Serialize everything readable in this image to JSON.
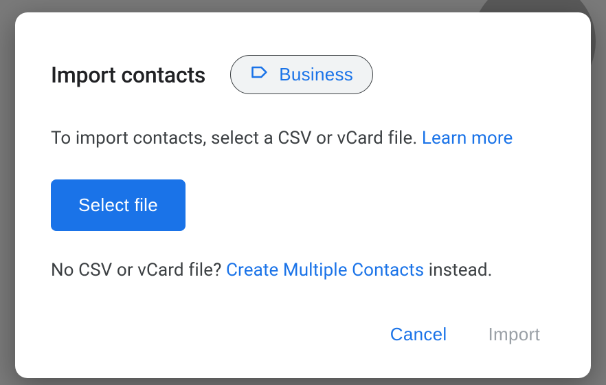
{
  "dialog": {
    "title": "Import contacts",
    "label_chip": "Business",
    "instruction_text": "To import contacts, select a CSV or vCard file. ",
    "learn_more": "Learn more",
    "select_file_button": "Select file",
    "hint_prefix": "No CSV or vCard file? ",
    "create_multiple_link": "Create Multiple Contacts",
    "hint_suffix": " instead.",
    "cancel_button": "Cancel",
    "import_button": "Import"
  }
}
